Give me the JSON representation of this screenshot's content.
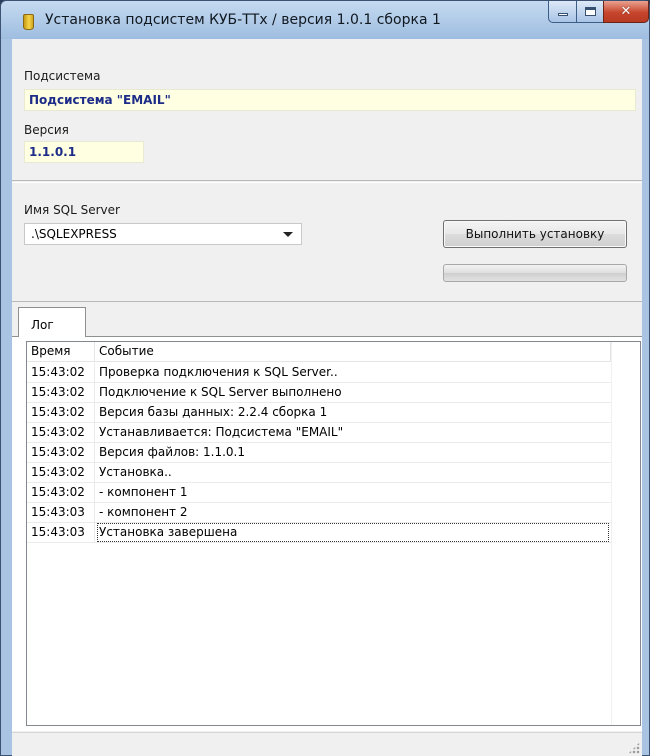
{
  "window": {
    "title": "Установка подсистем КУБ-ТТх / версия 1.0.1 сборка 1"
  },
  "subsystem": {
    "label": "Подсистема",
    "value": "Подсистема \"EMAIL\""
  },
  "version": {
    "label": "Версия",
    "value": "1.1.0.1"
  },
  "sql_server": {
    "label": "Имя SQL Server",
    "selected": ".\\SQLEXPRESS"
  },
  "install_button": {
    "label": "Выполнить установку"
  },
  "progress": {
    "percent": 0
  },
  "tabs": [
    {
      "label": "Лог",
      "active": true
    }
  ],
  "log": {
    "columns": [
      "Время",
      "Событие"
    ],
    "rows": [
      {
        "time": "15:43:02",
        "event": "Проверка подключения к SQL Server.."
      },
      {
        "time": "15:43:02",
        "event": "Подключение к SQL Server выполнено"
      },
      {
        "time": "15:43:02",
        "event": "Версия базы данных: 2.2.4 сборка 1"
      },
      {
        "time": "15:43:02",
        "event": "Устанавливается: Подсистема \"EMAIL\""
      },
      {
        "time": "15:43:02",
        "event": "Версия файлов: 1.1.0.1"
      },
      {
        "time": "15:43:02",
        "event": "Установка.."
      },
      {
        "time": "15:43:02",
        "event": "- компонент 1"
      },
      {
        "time": "15:43:03",
        "event": "- компонент 2"
      },
      {
        "time": "15:43:03",
        "event": "Установка завершена",
        "focused": true
      }
    ]
  },
  "icons": {
    "app": "cylinder-icon",
    "minimize": "minimize-icon",
    "maximize": "maximize-icon",
    "close": "close-icon",
    "dropdown": "chevron-down-icon"
  },
  "colors": {
    "readonly_field_bg": "#ffffe1",
    "readonly_field_text": "#1c2c88",
    "title_bar": "#a9c4e2",
    "close_button": "#c7452d"
  }
}
